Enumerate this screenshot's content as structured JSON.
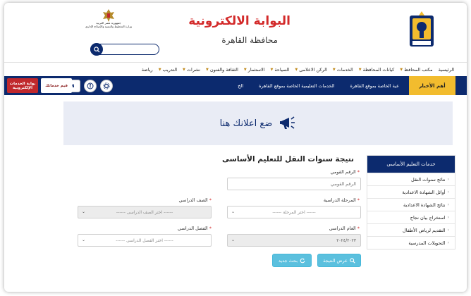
{
  "header": {
    "title": "البوابة الالكترونية",
    "subtitle": "محافظة القاهرة",
    "gov_text_line1": "جمهورية مصر العربية",
    "gov_text_line2": "وزارة التخطيط والتنمية والإصلاح الإداري",
    "search": {
      "value": "",
      "placeholder": ""
    }
  },
  "nav": [
    {
      "label": "الرئيسية",
      "caret": false
    },
    {
      "label": "مكتب المحافظ",
      "caret": true
    },
    {
      "label": "كيانات المحافظة",
      "caret": true
    },
    {
      "label": "الخدمات",
      "caret": true
    },
    {
      "label": "الركن الاعلامى",
      "caret": true
    },
    {
      "label": "السياحة",
      "caret": true
    },
    {
      "label": "الاستثمار",
      "caret": true
    },
    {
      "label": "الثقافة والفنون",
      "caret": true
    },
    {
      "label": "نشرات",
      "caret": true
    },
    {
      "label": "التدريب",
      "caret": true
    },
    {
      "label": "رياضة",
      "caret": false
    }
  ],
  "news": {
    "label": "أهم الأخبار",
    "items": [
      "عية الخاصة بموقع القاهرة",
      "الخدمات التعليمية الخاصة بموقع القاهرة",
      "الخ"
    ],
    "icon_en": "EN",
    "service1": "قيم خدماتك",
    "service2": "بوابة الخدمات الإلكترونية"
  },
  "ad": {
    "text": "ضع اعلانك هنا"
  },
  "sidebar": {
    "title": "خدمات التعليم الأساسى",
    "items": [
      "نتائج سنوات النقل",
      "أوائل الشهادة الاعدادية",
      "نتائج الشهادة الاعدادية",
      "استخراج بيان نجاح",
      "التقديم لرياض الأطفال",
      "التحويلات المدرسية"
    ]
  },
  "form": {
    "title": "نتيجة سنوات النقل للتعليم الأساسى",
    "national_id": {
      "label": "الرقم القومي",
      "placeholder": "الرقم القومي",
      "value": ""
    },
    "stage": {
      "label": "المرحلة الدراسية",
      "selected": "------ اختر المرحلة ------"
    },
    "grade": {
      "label": "الصف الدراسي",
      "selected": "------ اختر الصف الدراسى ------"
    },
    "year": {
      "label": "العام الدراسي",
      "selected": "٢٠٢٤/٢٠٢٣"
    },
    "term": {
      "label": "الفصل الدراسي",
      "selected": "------ اختر الفصل الدراسى ------"
    },
    "submit_label": "عرض النتيجة",
    "new_search_label": "بحث جديد"
  },
  "colors": {
    "navy": "#0c2a6e",
    "gold": "#f2bc2e",
    "red": "#d32a2a",
    "button": "#5bc0de"
  }
}
